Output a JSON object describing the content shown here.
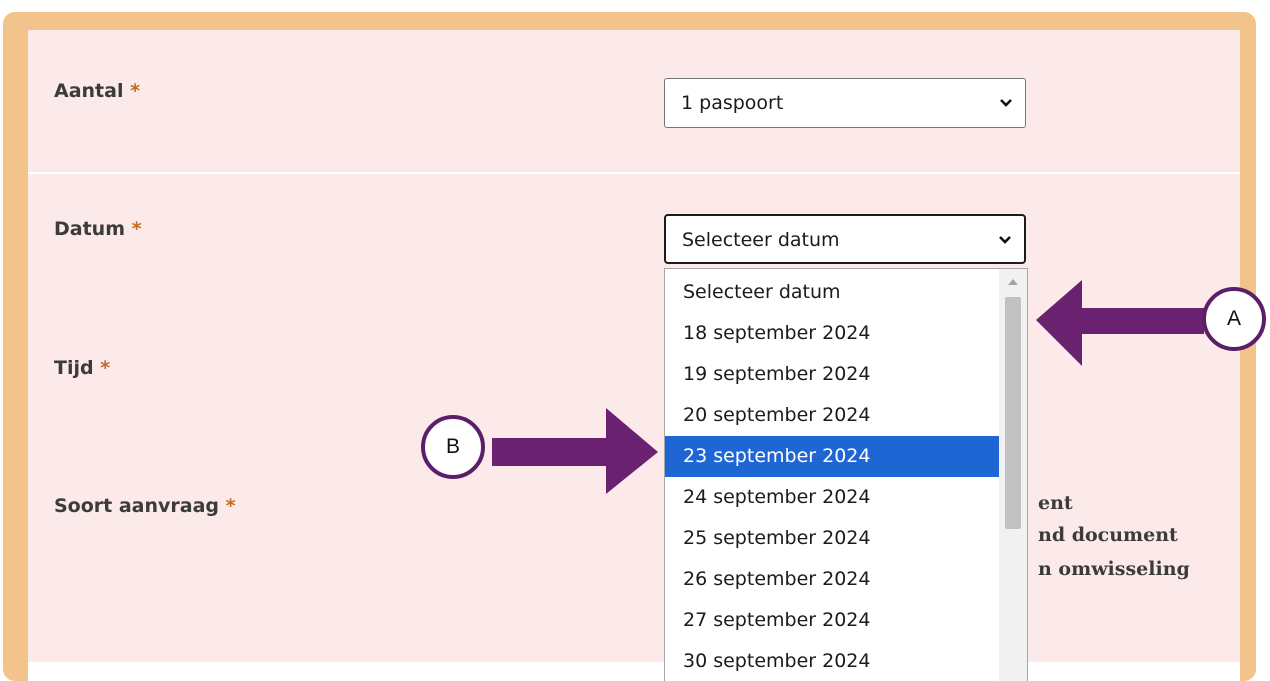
{
  "form": {
    "aantal": {
      "label": "Aantal",
      "required": "*",
      "value": "1 paspoort"
    },
    "datum": {
      "label": "Datum",
      "required": "*",
      "value": "Selecteer datum"
    },
    "tijd": {
      "label": "Tijd",
      "required": "*"
    },
    "soort_aanvraag": {
      "label": "Soort aanvraag",
      "required": "*",
      "partial_options": [
        "ent",
        "nd document",
        "n omwisseling"
      ]
    }
  },
  "datum_dropdown": {
    "options": [
      "Selecteer datum",
      "18 september 2024",
      "19 september 2024",
      "20 september 2024",
      "23 september 2024",
      "24 september 2024",
      "25 september 2024",
      "26 september 2024",
      "27 september 2024",
      "30 september 2024"
    ],
    "highlighted": "23 september 2024"
  },
  "annotations": {
    "a": {
      "label": "A"
    },
    "b": {
      "label": "B"
    }
  },
  "colors": {
    "frame": "#f2c48c",
    "card_bg": "#fce9e9",
    "required_star": "#c7681e",
    "highlight": "#1e66d4",
    "arrow": "#6a2270"
  },
  "icons": {
    "select_chevron": "chevron-down-icon",
    "scroll_up": "scroll-up-icon"
  }
}
